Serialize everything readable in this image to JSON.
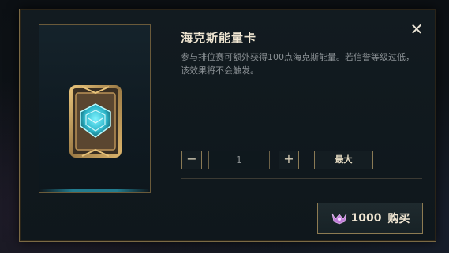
{
  "dialog": {
    "title": "海克斯能量卡",
    "description": "参与排位赛可额外获得100点海克斯能量。若信誉等级过低，该效果将不会触发。",
    "close_glyph": "✕"
  },
  "quantity": {
    "minus_glyph": "−",
    "value": "1",
    "plus_glyph": "+",
    "max_label": "最大"
  },
  "purchase": {
    "price": "1000",
    "label": "购买",
    "currency_icon": "hextech-currency-icon"
  },
  "colors": {
    "accent_gold": "#8a7a55",
    "card_glow": "#3fd8e8",
    "currency_purple": "#c07ad8"
  }
}
